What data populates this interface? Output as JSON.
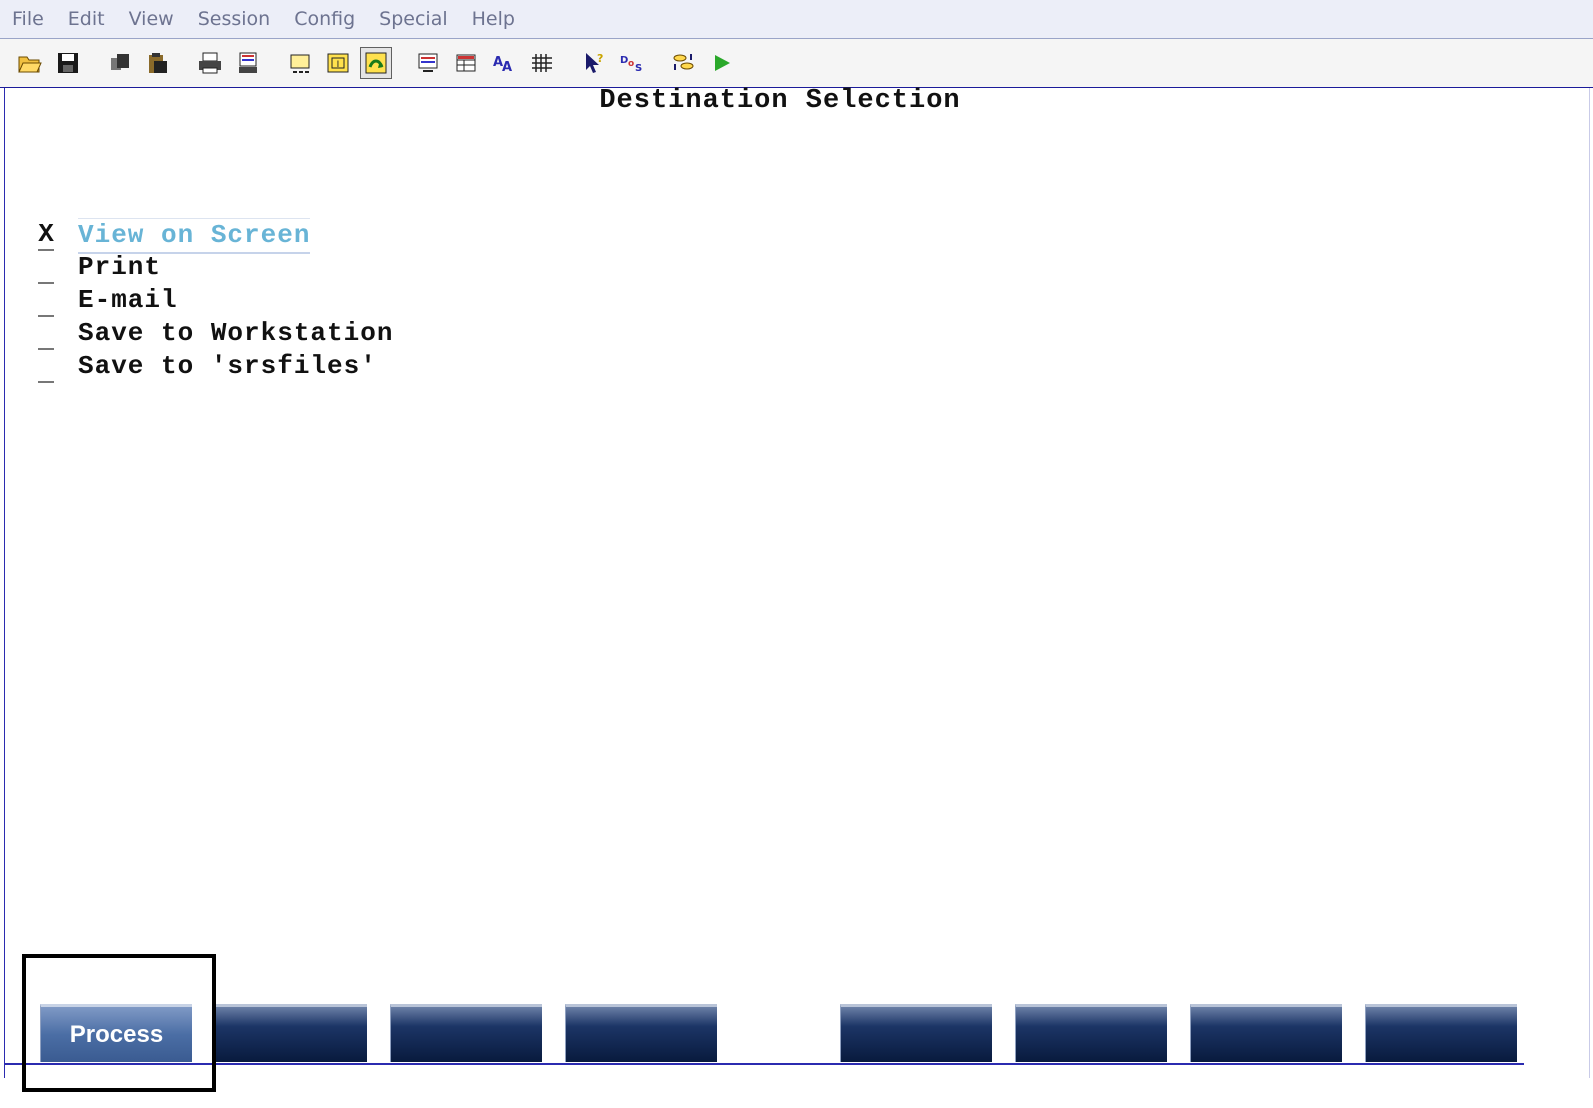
{
  "menu": [
    "File",
    "Edit",
    "View",
    "Session",
    "Config",
    "Special",
    "Help"
  ],
  "toolbar": {
    "icons": [
      "open-folder-icon",
      "save-icon",
      "copy-icon",
      "paste-icon",
      "print-icon",
      "print-screen-icon",
      "macro-icon",
      "attention-icon",
      "hotspot-icon",
      "display-icon",
      "field-icon",
      "font-icon",
      "keypad-icon",
      "help-pointer-icon",
      "dos-icon",
      "transfer-icon",
      "play-icon"
    ]
  },
  "screen": {
    "title": "Destination Selection",
    "options": [
      {
        "marker": "X",
        "label": "View on Screen",
        "active": true
      },
      {
        "marker": "",
        "label": "Print",
        "active": false
      },
      {
        "marker": "",
        "label": "E-mail",
        "active": false
      },
      {
        "marker": "",
        "label": "Save to Workstation",
        "active": false
      },
      {
        "marker": "",
        "label": "Save to 'srsfiles'",
        "active": false
      }
    ]
  },
  "fkeys": {
    "process_label": "Process"
  },
  "colors": {
    "active_option": "#68b4d6",
    "fkey_dark": "#081a3d",
    "fkey_process": "#4b6ea5",
    "frame_border": "#2b2bb0"
  }
}
